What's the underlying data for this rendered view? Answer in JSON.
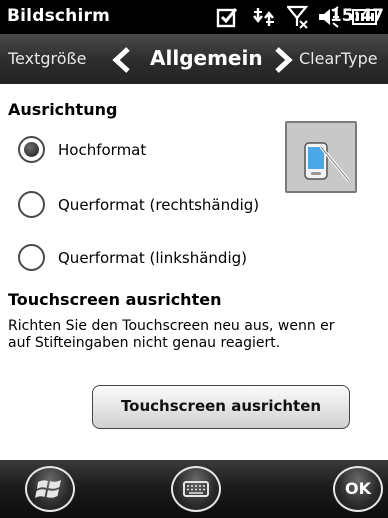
{
  "status_bar": {
    "title": "Bildschirm",
    "time": "15:47",
    "icons": [
      "checkbox-icon",
      "connectivity-arrows-icon",
      "no-signal-icon",
      "speaker-icon",
      "battery-icon"
    ]
  },
  "tabs": {
    "previous": "Textgröße",
    "current": "Allgemein",
    "next": "ClearType"
  },
  "orientation": {
    "heading": "Ausrichtung",
    "options": [
      {
        "label": "Hochformat",
        "selected": true
      },
      {
        "label": "Querformat (rechtshändig)",
        "selected": false
      },
      {
        "label": "Querformat (linkshändig)",
        "selected": false
      }
    ]
  },
  "calibration": {
    "heading": "Touchscreen ausrichten",
    "description": "Richten Sie den Touchscreen neu aus, wenn er auf Stifteingaben nicht genau reagiert.",
    "button_label": "Touchscreen ausrichten"
  },
  "bottom_bar": {
    "ok_label": "OK"
  }
}
